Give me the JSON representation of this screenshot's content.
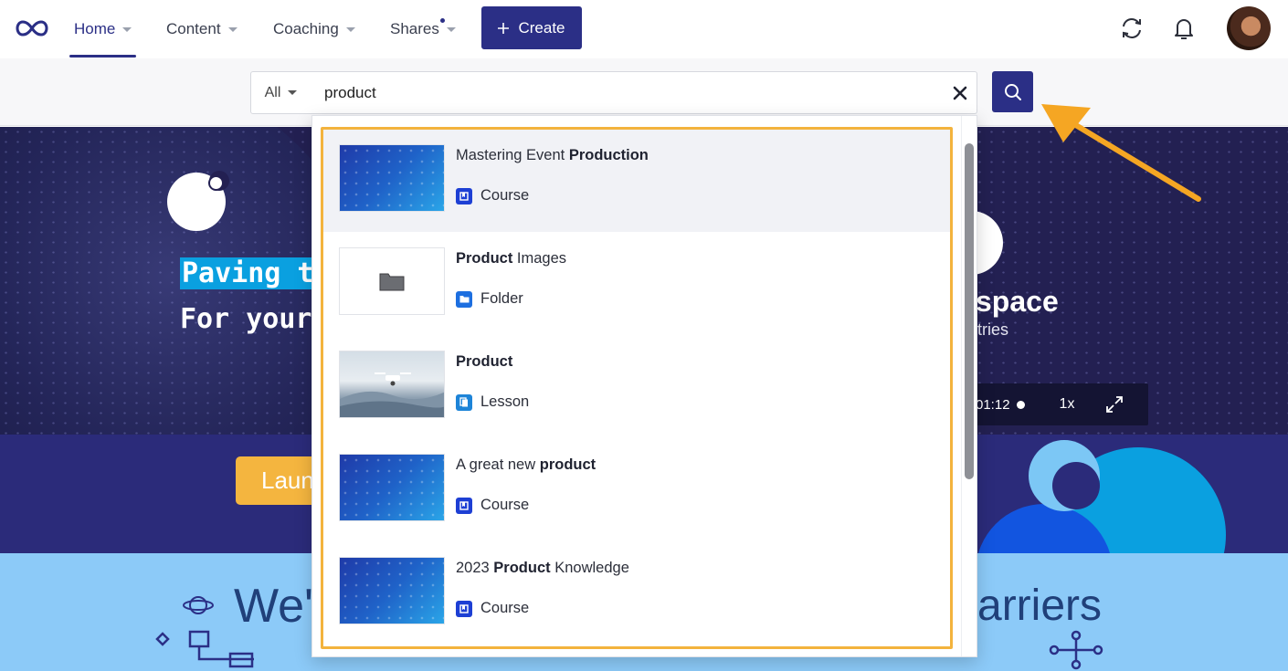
{
  "nav": {
    "items": [
      {
        "label": "Home",
        "active": true
      },
      {
        "label": "Content",
        "active": false
      },
      {
        "label": "Coaching",
        "active": false
      },
      {
        "label": "Shares",
        "active": false
      }
    ],
    "create_label": "Create",
    "icons": {
      "logo": "infinity-logo-icon",
      "sync": "sync-icon",
      "notifications": "bell-icon",
      "avatar": "user-avatar"
    }
  },
  "search": {
    "scope": "All",
    "query": "product",
    "clear_icon": "close-icon",
    "submit_icon": "search-icon"
  },
  "results": [
    {
      "pre": "Mastering Event ",
      "match": "Production",
      "post": "",
      "type": "Course",
      "thumb": "course",
      "hover": true
    },
    {
      "pre": "",
      "match": "Product",
      "post": " Images",
      "type": "Folder",
      "thumb": "folder",
      "hover": false
    },
    {
      "pre": "",
      "match": "Product",
      "post": "",
      "type": "Lesson",
      "thumb": "lesson",
      "hover": false
    },
    {
      "pre": "A great new ",
      "match": "product",
      "post": "",
      "type": "Course",
      "thumb": "course",
      "hover": false
    },
    {
      "pre": "2023 ",
      "match": "Product",
      "post": " Knowledge",
      "type": "Course",
      "thumb": "course",
      "hover": false
    }
  ],
  "background": {
    "hero_line1": "Paving t",
    "hero_line2": "For your",
    "brand_text": "space",
    "brand_sub": "tries",
    "video_time": "01:12",
    "video_speed": "1x",
    "launch_label": "Laun",
    "heading_left": "We'",
    "heading_right": "arriers"
  },
  "colors": {
    "accent": "#2b2f86",
    "highlight": "#f3b33d",
    "hero_bg": "#232052",
    "lower_bg": "#8ccaf8"
  }
}
